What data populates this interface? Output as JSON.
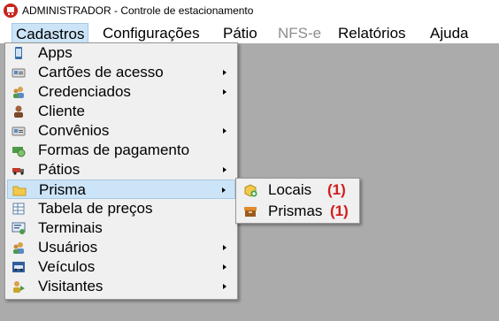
{
  "window": {
    "title": "ADMINISTRADOR - Controle de estacionamento",
    "app_icon": "parking-app-icon"
  },
  "menubar": {
    "items": [
      {
        "label": "Cadastros",
        "state": "open"
      },
      {
        "label": "Configurações"
      },
      {
        "label": "Pátio"
      },
      {
        "label": "NFS-e",
        "state": "disabled"
      },
      {
        "label": "Relatórios"
      },
      {
        "label": "Ajuda"
      }
    ]
  },
  "cadastros_menu": {
    "items": [
      {
        "label": "Apps",
        "icon": "phone-icon",
        "submenu": false
      },
      {
        "label": "Cartões de acesso",
        "icon": "card-icon",
        "submenu": true
      },
      {
        "label": "Credenciados",
        "icon": "users-icon",
        "submenu": true
      },
      {
        "label": "Cliente",
        "icon": "person-icon",
        "submenu": false
      },
      {
        "label": "Convênios",
        "icon": "card-icon",
        "submenu": true
      },
      {
        "label": "Formas de pagamento",
        "icon": "money-icon",
        "submenu": false
      },
      {
        "label": "Pátios",
        "icon": "truck-icon",
        "submenu": true
      },
      {
        "label": "Prisma",
        "icon": "folder-icon",
        "submenu": true,
        "highlighted": true
      },
      {
        "label": "Tabela de preços",
        "icon": "table-icon",
        "submenu": false
      },
      {
        "label": "Terminais",
        "icon": "terminal-icon",
        "submenu": false
      },
      {
        "label": "Usuários",
        "icon": "users-icon",
        "submenu": true
      },
      {
        "label": "Veículos",
        "icon": "car-icon",
        "submenu": true
      },
      {
        "label": "Visitantes",
        "icon": "visitor-icon",
        "submenu": true
      }
    ]
  },
  "prisma_submenu": {
    "items": [
      {
        "label": "Locais",
        "count": "(1)",
        "icon": "add-location-icon"
      },
      {
        "label": "Prismas",
        "count": "(1)",
        "icon": "box-icon"
      }
    ]
  },
  "colors": {
    "highlight": "#cce4f7",
    "count": "#d41c1c",
    "background": "#ababab"
  }
}
